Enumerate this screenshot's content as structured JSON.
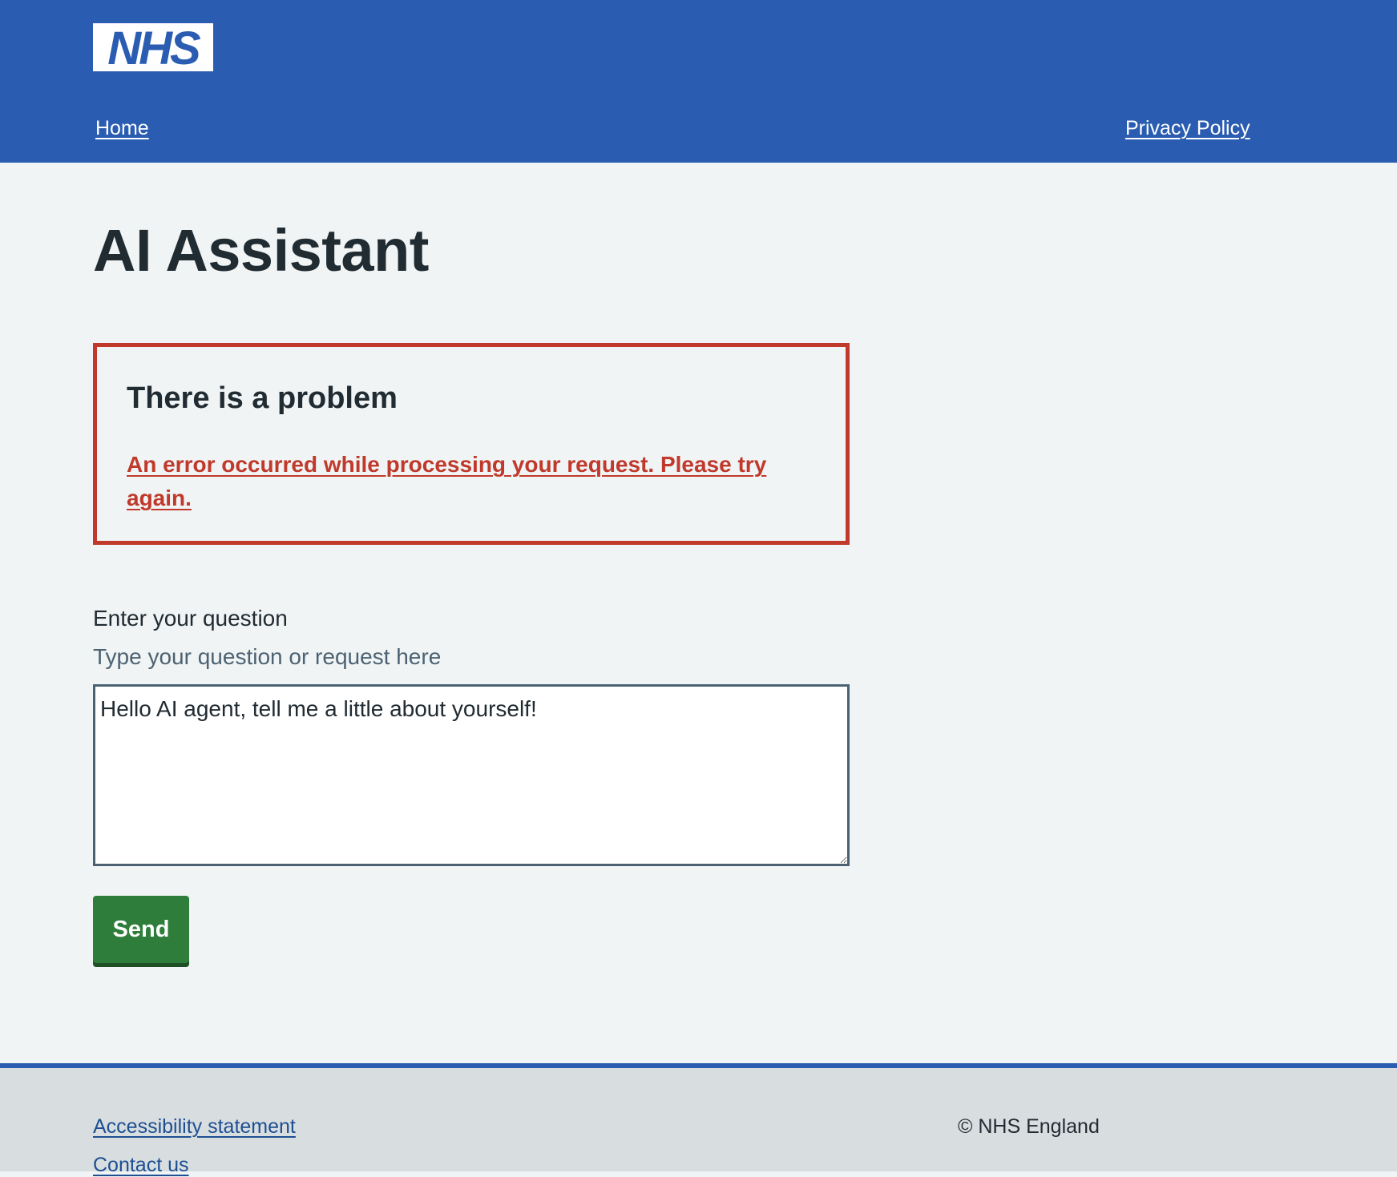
{
  "header": {
    "logo_text": "NHS",
    "nav": {
      "home": "Home",
      "privacy": "Privacy Policy"
    }
  },
  "main": {
    "title": "AI Assistant",
    "error_summary": {
      "title": "There is a problem",
      "message": "An error occurred while processing your request. Please try again."
    },
    "question": {
      "label": "Enter your question",
      "hint": "Type your question or request here",
      "value": "Hello AI agent, tell me a little about yourself!"
    },
    "send_label": "Send"
  },
  "footer": {
    "links": [
      "Accessibility statement",
      "Contact us"
    ],
    "copyright": "© NHS England"
  },
  "colors": {
    "brand_blue": "#2a5db1",
    "error_red": "#c0392b",
    "button_green": "#2e7d3a",
    "page_background": "#f0f4f5",
    "footer_background": "#d8dde0"
  },
  "icons": [
    "nhs-logo-icon"
  ]
}
